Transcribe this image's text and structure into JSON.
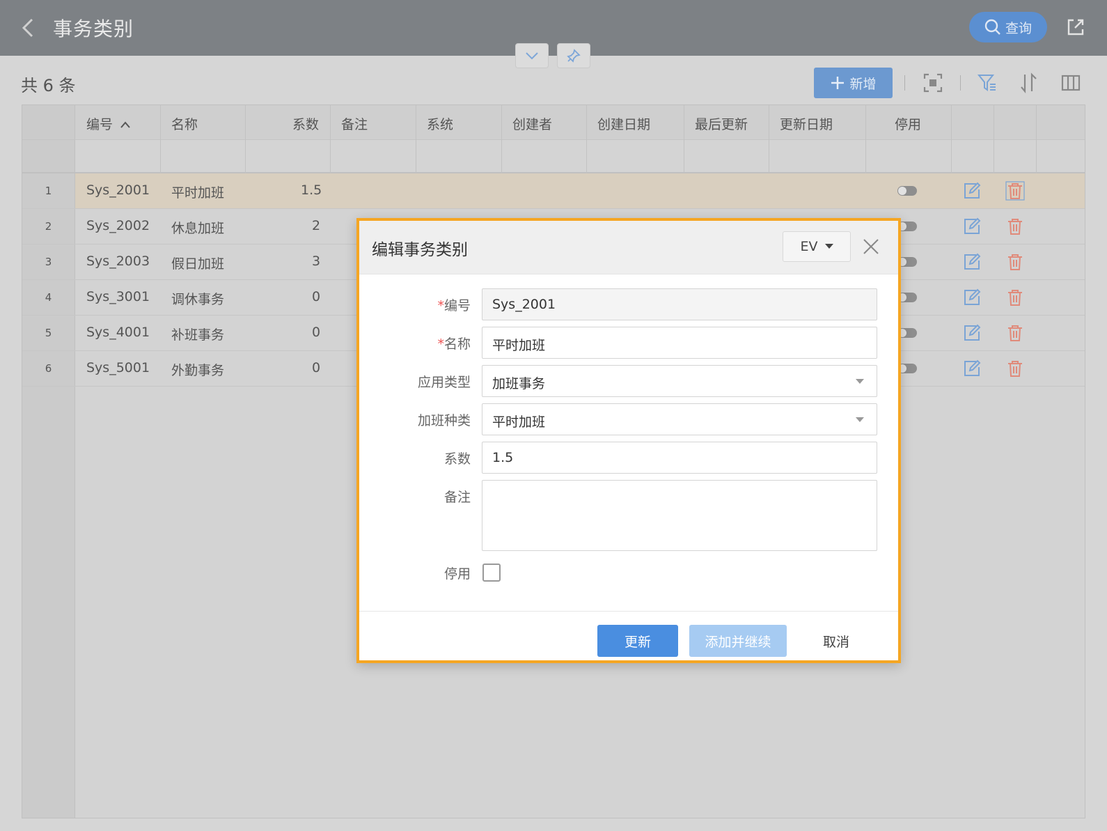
{
  "header": {
    "title": "事务类别",
    "query_label": "查询"
  },
  "toolbar": {
    "count_label": "共 6 条",
    "add_label": "新增"
  },
  "table": {
    "columns": [
      "编号",
      "名称",
      "系数",
      "备注",
      "系统",
      "创建者",
      "创建日期",
      "最后更新",
      "更新日期",
      "停用"
    ],
    "rows": [
      {
        "num": "1",
        "code": "Sys_2001",
        "name": "平时加班",
        "factor": "1.5"
      },
      {
        "num": "2",
        "code": "Sys_2002",
        "name": "休息加班",
        "factor": "2"
      },
      {
        "num": "3",
        "code": "Sys_2003",
        "name": "假日加班",
        "factor": "3"
      },
      {
        "num": "4",
        "code": "Sys_3001",
        "name": "调休事务",
        "factor": "0"
      },
      {
        "num": "5",
        "code": "Sys_4001",
        "name": "补班事务",
        "factor": "0"
      },
      {
        "num": "6",
        "code": "Sys_5001",
        "name": "外勤事务",
        "factor": "0"
      }
    ]
  },
  "modal": {
    "title": "编辑事务类别",
    "lang": "EV",
    "fields": {
      "code_label": "编号",
      "code_value": "Sys_2001",
      "name_label": "名称",
      "name_value": "平时加班",
      "apply_type_label": "应用类型",
      "apply_type_value": "加班事务",
      "ot_kind_label": "加班种类",
      "ot_kind_value": "平时加班",
      "factor_label": "系数",
      "factor_value": "1.5",
      "remark_label": "备注",
      "disabled_label": "停用"
    },
    "buttons": {
      "update": "更新",
      "add_continue": "添加并继续",
      "cancel": "取消"
    }
  },
  "colors": {
    "accent": "#4a8ee0",
    "modal_border": "#f5a623",
    "header_bg": "#7d8185"
  }
}
